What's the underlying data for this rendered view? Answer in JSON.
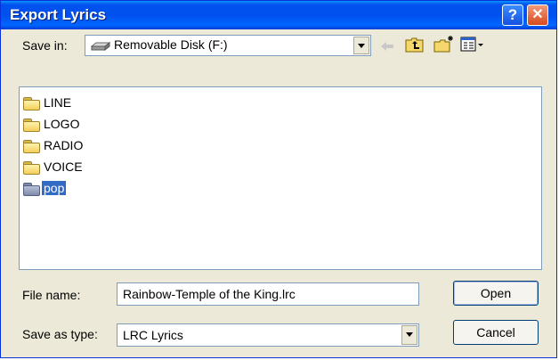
{
  "window": {
    "title": "Export Lyrics",
    "help_glyph": "?",
    "close_glyph": "✕"
  },
  "toolbar": {
    "save_in_label": "Save in:",
    "save_in_value": "Removable Disk (F:)",
    "icons": [
      "back-arrow-icon",
      "up-one-level-icon",
      "create-new-folder-icon",
      "view-menu-icon"
    ]
  },
  "files": [
    {
      "name": "LINE",
      "type": "folder",
      "selected": false
    },
    {
      "name": "LOGO",
      "type": "folder",
      "selected": false
    },
    {
      "name": "RADIO",
      "type": "folder",
      "selected": false
    },
    {
      "name": "VOICE",
      "type": "folder",
      "selected": false
    },
    {
      "name": "pop",
      "type": "folder",
      "selected": true
    }
  ],
  "form": {
    "file_name_label": "File name:",
    "file_name_value": "Rainbow-Temple of the King.lrc",
    "save_as_type_label": "Save as type:",
    "save_as_type_value": "LRC Lyrics"
  },
  "buttons": {
    "open": "Open",
    "cancel": "Cancel"
  },
  "colors": {
    "titlebar": "#0054e3",
    "selection": "#316ac5",
    "dialog_bg": "#ece9d8"
  }
}
